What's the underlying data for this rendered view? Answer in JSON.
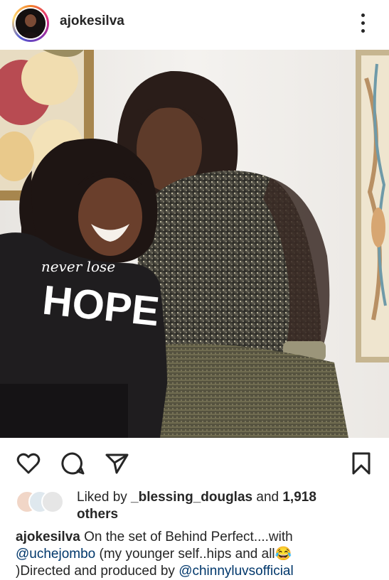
{
  "post": {
    "username": "ajokesilva",
    "photo_shirt_text_top": "never lose",
    "photo_shirt_text_main": "HOPE"
  },
  "likes": {
    "prefix": "Liked by ",
    "liker": "_blessing_douglas",
    "middle": " and ",
    "count": "1,918",
    "suffix": "others"
  },
  "caption": {
    "username": "ajokesilva",
    "line1_text": " On the set of Behind Perfect....with",
    "mention": "@uchejombo",
    "line2_text": " (my younger self..hips and all",
    "emoji": "😂",
    "line3_text": ")Directed and produced by ",
    "mention2": "@chinnyluvsofficial"
  },
  "icons": {
    "more": "more-vertical-icon",
    "like": "heart-icon",
    "comment": "comment-icon",
    "share": "send-icon",
    "save": "bookmark-icon"
  },
  "colors": {
    "text": "#262626",
    "mention": "#00376b",
    "background": "#ffffff"
  }
}
